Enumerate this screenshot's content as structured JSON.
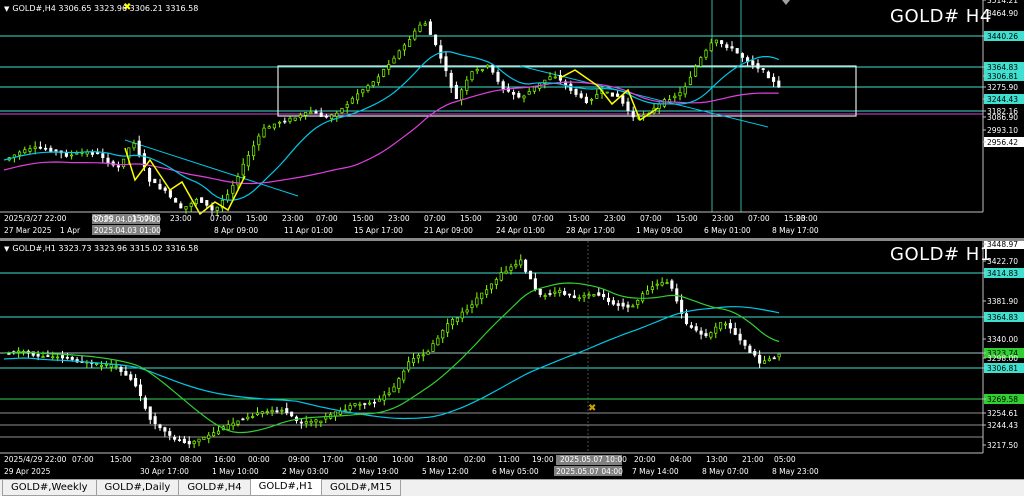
{
  "top": {
    "title": "GOLD# H4",
    "ohlc": "GOLD#,H4  3306.65 3323.96 3306.21 3316.58",
    "price_labels": [
      "3514.21",
      "3464.90",
      "3440.26",
      "3364.83",
      "3306.81",
      "3275.90",
      "3244.43",
      "3182.16",
      "3086.90",
      "2993.10",
      "2956.42"
    ],
    "time_labels": [
      "2025/3/27 22:00",
      "07:00",
      "15:00",
      "23:00",
      "07:00",
      "15:00",
      "23:00",
      "07:00",
      "15:00",
      "23:00",
      "07:00",
      "15:00",
      "23:00",
      "07:00",
      "15:00",
      "23:00",
      "07:00",
      "15:00",
      "23:00",
      "07:00",
      "15:00",
      "23:00"
    ],
    "date_labels": [
      "27 Mar 2025",
      "1 Apr",
      "4 Apr 17:00",
      "8 Apr 09:00",
      "11 Apr 01:00",
      "15 Apr 17:00",
      "21 Apr 09:00",
      "24 Apr 01:00",
      "28 Apr 17:00",
      "1 May 09:00",
      "6 May 01:00",
      "8 May 17:00"
    ],
    "crosshair_time": "2025.04.03 07:00",
    "crosshair_date": "2025.04.03 01:00"
  },
  "bottom": {
    "title": "GOLD# H1",
    "ohlc": "GOLD#,H1  3323.73 3323.96 3315.02 3316.58",
    "price_labels": [
      "3448.97",
      "3422.70",
      "3414.83",
      "3381.90",
      "3364.83",
      "3340.00",
      "3323.74",
      "3306.81",
      "3298.00",
      "3269.58",
      "3254.61",
      "3244.43",
      "3217.50"
    ],
    "time_labels": [
      "2025/4/29 22:00",
      "07:00",
      "15:00",
      "23:00",
      "08:00",
      "16:00",
      "00:00",
      "09:00",
      "17:00",
      "01:00",
      "10:00",
      "18:00",
      "02:00",
      "11:00",
      "19:00",
      "2025.05.07 10:00",
      "20:00",
      "04:00",
      "13:00",
      "21:00",
      "05:00"
    ],
    "date_labels": [
      "29 Apr 2025",
      "30 Apr 10:00",
      "30 Apr 17:00",
      "1 May 10:00",
      "2 May 03:00",
      "2 May 19:00",
      "5 May 12:00",
      "6 May 05:00",
      "2025.05.07 04:00",
      "7 May 14:00",
      "8 May 07:00",
      "8 May 23:00"
    ]
  },
  "tabs": [
    "GOLD#,Weekly",
    "GOLD#,Daily",
    "GOLD#,H4",
    "GOLD#,H1",
    "GOLD#,M15"
  ],
  "active_tab": "GOLD#,H1",
  "colors": {
    "background": "#000000",
    "candle_up": "#7fff00",
    "candle_down": "#ffffff",
    "ma_cyan": "#00c8e8",
    "ma_magenta": "#e040e0",
    "ma_green": "#30d030",
    "zigzag": "#ffff00",
    "level_line": "#40e0d0"
  }
}
